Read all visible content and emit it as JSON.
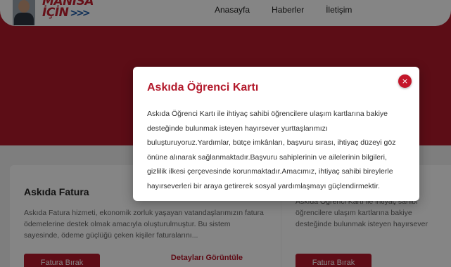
{
  "header": {
    "logo": {
      "line1": "MANISA",
      "line2": "İÇİN",
      "chevrons": ">>>"
    },
    "nav": [
      {
        "label": "Anasayfa"
      },
      {
        "label": "Haberler"
      },
      {
        "label": "İletişim"
      }
    ]
  },
  "cards": [
    {
      "title": "Askıda Fatura",
      "body": "Askıda Fatura hizmeti, ekonomik zorluk yaşayan vatandaşlarımızın fatura ödemelerine destek olmak amacıyla oluşturulmuştur. Bu sistem sayesinde, ödeme güçlüğü çeken kişiler faturalarını...",
      "button": "Fatura Bırak",
      "link": "Detayları Görüntüle"
    },
    {
      "title": "",
      "body": "Askıda Öğrenci Kartı ile ihtiyaç sahibi öğrencilere ulaşım kartlarına bakiye desteğinde bulunmak isteyen hayırsever yurttaşlarımızı buluşturuyoruz.Yardımlar, bütçe imkânları...",
      "button": "Fatura Bırak",
      "link": ""
    }
  ],
  "modal": {
    "title": "Askıda Öğrenci Kartı",
    "close_icon": "×",
    "body": "Askıda Öğrenci Kartı ile ihtiyaç sahibi öğrencilere ulaşım kartlarına bakiye desteğinde bulunmak isteyen hayırsever yurttaşlarımızı buluşturuyoruz.Yardımlar, bütçe imkânları, başvuru sırası, ihtiyaç düzeyi göz önüne alınarak sağlanmaktadır.Başvuru sahiplerinin ve ailelerinin bilgileri, gizlilik ilkesi çerçevesinde korunmaktadır.Amacımız, ihtiyaç sahibi bireylerle hayırseverleri bir araya getirerek sosyal yardımlaşmayı güçlendirmektir."
  },
  "colors": {
    "brand_red": "#b01a2b",
    "overlay": "rgba(0,0,0,0.48)",
    "logo_blue": "#1e5aa8"
  }
}
